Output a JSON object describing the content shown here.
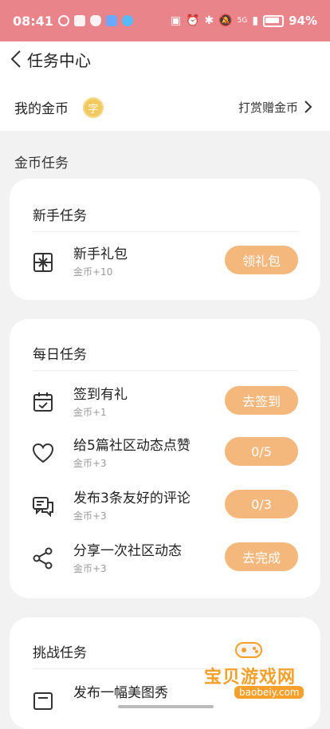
{
  "status": {
    "time": "08:41",
    "battery": "94%",
    "signal_label": "5G"
  },
  "header": {
    "title": "任务中心",
    "my_coins_label": "我的金币",
    "coin_badge_char": "字",
    "reward_link": "打赏赠金币"
  },
  "section": {
    "title": "金币任务"
  },
  "cards": {
    "newbie": {
      "title": "新手任务",
      "tasks": [
        {
          "name": "新手礼包",
          "reward": "金币+10",
          "button": "领礼包",
          "icon": "gift-icon"
        }
      ]
    },
    "daily": {
      "title": "每日任务",
      "tasks": [
        {
          "name": "签到有礼",
          "reward": "金币+1",
          "button": "去签到",
          "icon": "calendar-check-icon"
        },
        {
          "name": "给5篇社区动态点赞",
          "reward": "金币+3",
          "button": "0/5",
          "icon": "heart-icon"
        },
        {
          "name": "发布3条友好的评论",
          "reward": "金币+3",
          "button": "0/3",
          "icon": "comment-icon"
        },
        {
          "name": "分享一次社区动态",
          "reward": "金币+3",
          "button": "去完成",
          "icon": "share-icon"
        }
      ]
    },
    "challenge": {
      "title": "挑战任务",
      "tasks": [
        {
          "name": "发布一幅美图秀",
          "icon": "image-post-icon"
        }
      ]
    }
  },
  "watermark": {
    "text": "宝贝游戏网",
    "url": "baobeiy.com"
  },
  "colors": {
    "accent": "#f4b77c",
    "status_bar": "#e9848a",
    "coin": "#f2c95f"
  }
}
